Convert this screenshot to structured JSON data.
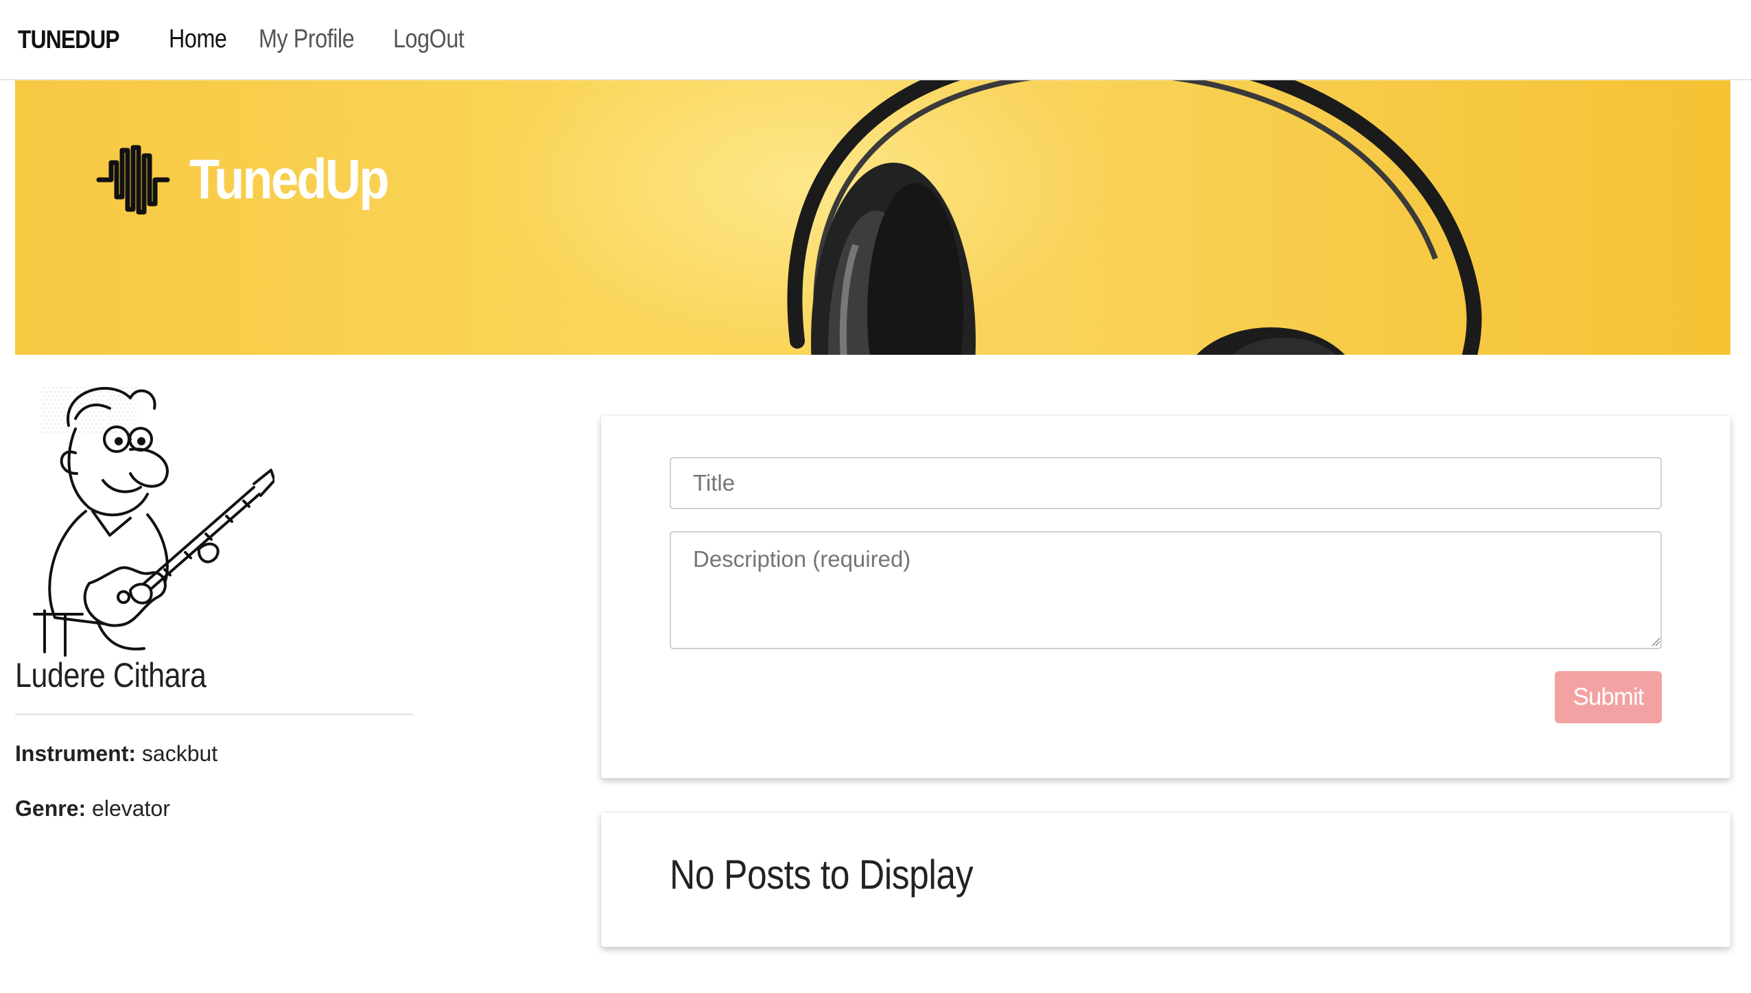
{
  "navbar": {
    "brand": "TUNEDUP",
    "links": [
      {
        "label": "Home"
      },
      {
        "label": "My Profile"
      },
      {
        "label": "LogOut"
      }
    ]
  },
  "banner": {
    "logo_text": "TunedUp",
    "accent_color": "#f9d35a"
  },
  "profile": {
    "name": "Ludere Cithara",
    "instrument_label": "Instrument:",
    "instrument_value": "sackbut",
    "genre_label": "Genre:",
    "genre_value": "elevator"
  },
  "post_form": {
    "title_placeholder": "Title",
    "description_placeholder": "Description (required)",
    "submit_label": "Submit",
    "submit_color": "#f2a2a2"
  },
  "posts": {
    "empty_message": "No Posts to Display"
  }
}
